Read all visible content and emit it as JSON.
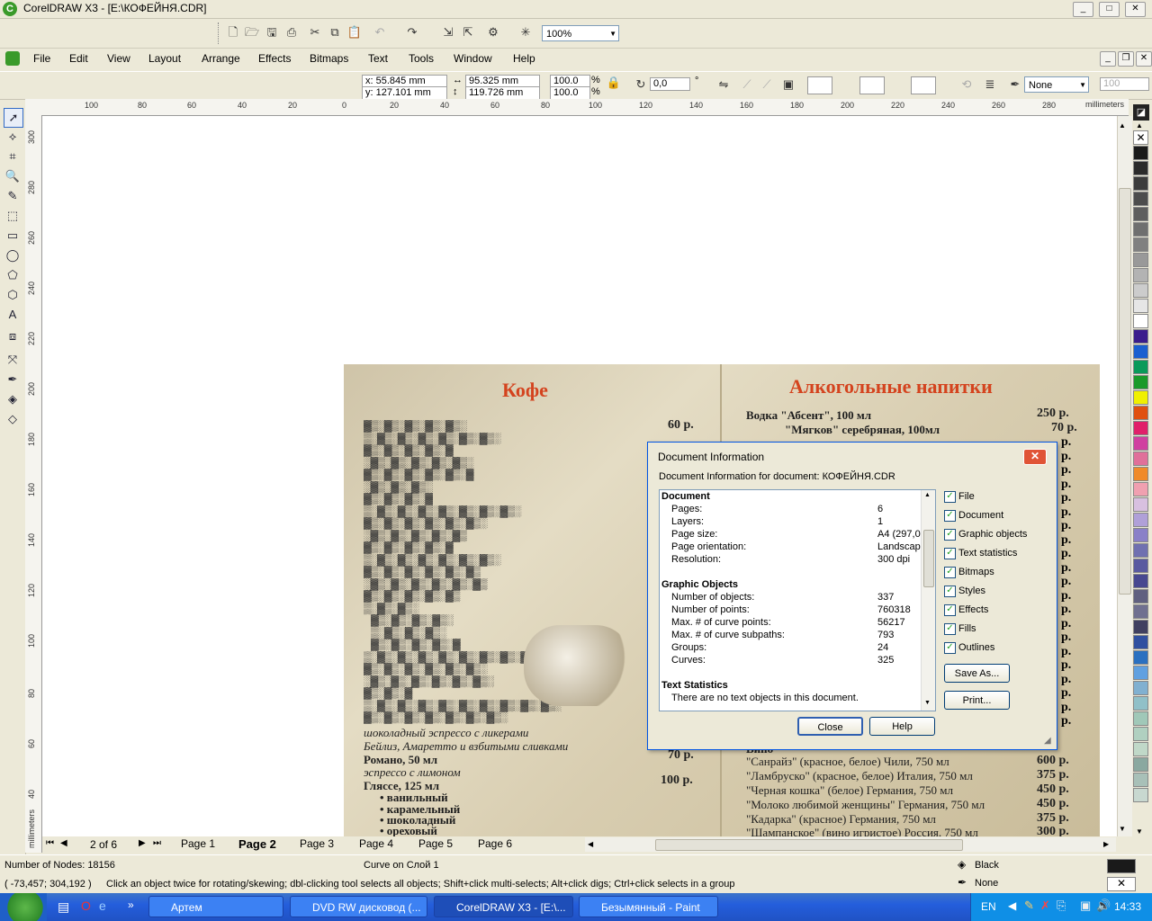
{
  "window": {
    "title": "CorelDRAW X3 - [E:\\КОФЕЙНЯ.CDR]",
    "min": "_",
    "max": "□",
    "close": "✕"
  },
  "toolbar": {
    "zoom": "100%"
  },
  "menubar": {
    "items": [
      "File",
      "Edit",
      "View",
      "Layout",
      "Arrange",
      "Effects",
      "Bitmaps",
      "Text",
      "Tools",
      "Window",
      "Help"
    ]
  },
  "propbar": {
    "x": "x: 55.845 mm",
    "y": "y: 127.101 mm",
    "w": "95.325 mm",
    "h": "119.726 mm",
    "sx": "100.0",
    "sy": "100.0",
    "pct": "%",
    "angle": "0,0",
    "deg": "°",
    "outline": "None",
    "size": "100"
  },
  "rulers": {
    "unit": "millimeters",
    "h": [
      "100",
      "80",
      "60",
      "40",
      "20",
      "0",
      "20",
      "40",
      "60",
      "80",
      "100",
      "120",
      "140",
      "160",
      "180",
      "200",
      "220",
      "240",
      "260",
      "280"
    ],
    "v": [
      "300",
      "280",
      "260",
      "240",
      "220",
      "200",
      "180",
      "160",
      "140",
      "120",
      "100",
      "80",
      "60",
      "40"
    ],
    "vunit": "millimeters"
  },
  "menupage": {
    "coffee_title": "Кофе",
    "alco_title": "Алкогольные напитки",
    "left_prices": [
      "60 р.",
      "70 р.",
      "100 р."
    ],
    "left_items": [
      {
        "name": "шоколадный эспрессо с ликерами"
      },
      {
        "name": "Бейлиз, Амаретто и взбитыми сливками"
      },
      {
        "name": "Романо, 50 мл"
      },
      {
        "name": "эспрессо с лимоном"
      },
      {
        "name": "Гляссе, 125 мл"
      },
      {
        "name": "• ванильный"
      },
      {
        "name": "• карамельный"
      },
      {
        "name": "• шоколадный"
      },
      {
        "name": "• ореховый"
      }
    ],
    "right_items": [
      {
        "name": "Водка \"Абсент\", 100 мл",
        "price": "250 р."
      },
      {
        "name": "\"Мягков\" серебряная, 100мл",
        "price": "70 р."
      },
      {
        "name": "\"Санрайз\" (красное, белое) Чили, 750 мл",
        "price": "600 р."
      },
      {
        "name": "\"Ламбруско\" (красное, белое) Италия, 750 мл",
        "price": "375 р."
      },
      {
        "name": "\"Черная кошка\" (белое) Германия, 750 мл",
        "price": "450 р."
      },
      {
        "name": "\"Молоко любимой женщины\" Германия, 750 мл",
        "price": "450 р."
      },
      {
        "name": "\"Кадарка\" (красное) Германия, 750 мл",
        "price": "375 р."
      },
      {
        "name": "\"Шампанское\" (вино игристое) Россия, 750 мл",
        "price": "300 р."
      }
    ],
    "wine_header": "Вино",
    "right_price_col": [
      "р.",
      "р.",
      "р.",
      "р.",
      "р.",
      "р.",
      "р.",
      "р.",
      "р.",
      "р.",
      "р.",
      "р.",
      "р.",
      "р.",
      "р.",
      "р.",
      "р.",
      "р.",
      "р.",
      "р.",
      "р."
    ]
  },
  "dialog": {
    "title": "Document Information",
    "subtitle": "Document Information for document: КОФЕЙНЯ.CDR",
    "sections": [
      {
        "header": "Document",
        "rows": [
          [
            "Pages:",
            "6"
          ],
          [
            "Layers:",
            "1"
          ],
          [
            "Page size:",
            "A4 (297,0"
          ],
          [
            "Page orientation:",
            "Landscap"
          ],
          [
            "Resolution:",
            "300 dpi"
          ]
        ]
      },
      {
        "header": "Graphic Objects",
        "rows": [
          [
            "Number of objects:",
            "337"
          ],
          [
            "Number of points:",
            "760318"
          ],
          [
            "Max. # of curve points:",
            "56217"
          ],
          [
            "Max. # of curve subpaths:",
            "793"
          ],
          [
            "Groups:",
            "24"
          ],
          [
            "Curves:",
            "325"
          ]
        ]
      },
      {
        "header": "Text Statistics",
        "rows": [
          [
            "There are no text objects in this document.",
            ""
          ]
        ]
      }
    ],
    "checks": [
      "File",
      "Document",
      "Graphic objects",
      "Text statistics",
      "Bitmaps",
      "Styles",
      "Effects",
      "Fills",
      "Outlines"
    ],
    "save_as": "Save As...",
    "print": "Print...",
    "close": "Close",
    "help": "Help"
  },
  "pagetabs": {
    "counter": "2 of 6",
    "tabs": [
      "Page 1",
      "Page 2",
      "Page 3",
      "Page 4",
      "Page 5",
      "Page 6"
    ],
    "active": 1
  },
  "status": {
    "nodes": "Number of Nodes: 18156",
    "layer": "Curve on Слой 1",
    "coords": "( -73,457; 304,192 )",
    "hint": "Click an object twice for rotating/skewing; dbl-clicking tool selects all objects; Shift+click multi-selects; Alt+click digs; Ctrl+click selects in a group",
    "fill": "Black",
    "outline": "None"
  },
  "taskbar": {
    "tasks": [
      "Артем",
      "DVD RW дисковод (...",
      "CorelDRAW X3 - [E:\\...",
      "Безымянный - Paint"
    ],
    "lang": "EN",
    "time": "14:33"
  },
  "palette": [
    "#ffffff",
    "#1a1a1a",
    "#2b2b2b",
    "#3c3c3c",
    "#4d4d4d",
    "#5e5e5e",
    "#6f6f6f",
    "#808080",
    "#999999",
    "#b3b3b3",
    "#cccccc",
    "#e6e6e6",
    "#ffffff",
    "#3a1c8c",
    "#1a5fd0",
    "#0a9a5a",
    "#1a9a2a",
    "#f0f000",
    "#e05010",
    "#e0206a",
    "#d040a0",
    "#e0709a",
    "#f08a2a",
    "#f0a0b0",
    "#d8c0e0",
    "#b0a0d8",
    "#8a80c8",
    "#7070b0",
    "#5a5aa0",
    "#484890",
    "#606080",
    "#707090",
    "#404060",
    "#3050a0",
    "#2a70c0",
    "#60a0e0",
    "#80b0d0",
    "#90c0c8",
    "#a0c8b8",
    "#b0d0c0",
    "#c0d8c8",
    "#8aa8a0",
    "#a8c0b8",
    "#c8d8d0"
  ]
}
